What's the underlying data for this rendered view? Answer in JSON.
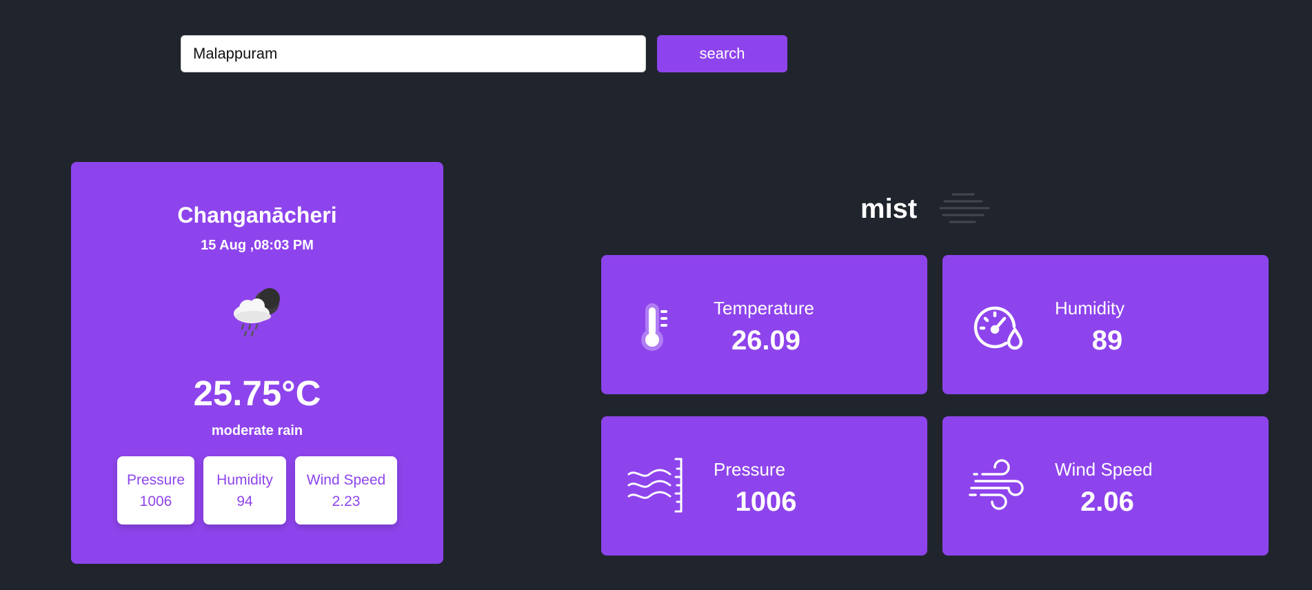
{
  "search": {
    "value": "Malappuram",
    "button_label": "search"
  },
  "current": {
    "city": "Changanācheri",
    "datetime": "15 Aug ,08:03 PM",
    "icon": "rain-cloud-moon-icon",
    "temperature": "25.75°C",
    "description": "moderate rain",
    "metrics": [
      {
        "label": "Pressure",
        "value": "1006"
      },
      {
        "label": "Humidity",
        "value": "94"
      },
      {
        "label": "Wind Speed",
        "value": "2.23"
      }
    ]
  },
  "summary": {
    "condition": "mist",
    "icon": "mist-icon"
  },
  "cards": [
    {
      "label": "Temperature",
      "value": "26.09",
      "icon": "thermometer-icon"
    },
    {
      "label": "Humidity",
      "value": "89",
      "icon": "humidity-gauge-icon"
    },
    {
      "label": "Pressure",
      "value": "1006",
      "icon": "pressure-waves-icon"
    },
    {
      "label": "Wind Speed",
      "value": "2.06",
      "icon": "wind-icon"
    }
  ],
  "colors": {
    "background": "#20252d",
    "accent": "#8e44ec",
    "card_text": "#ffffff"
  }
}
